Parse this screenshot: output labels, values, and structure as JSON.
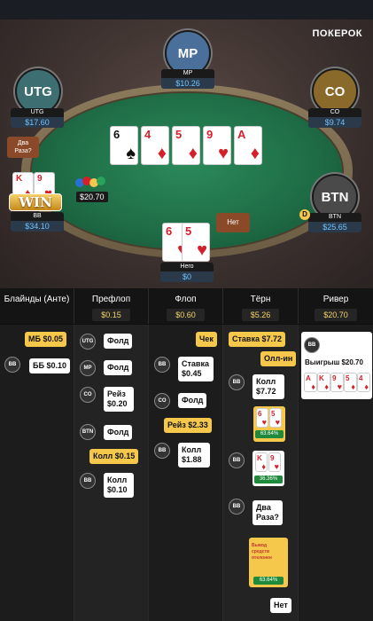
{
  "brand": "ПОКЕРОК",
  "seats": {
    "mp": {
      "name": "MP",
      "label": "MP",
      "stack": "$10.26"
    },
    "utg": {
      "name": "UTG",
      "label": "UTG",
      "stack": "$17.60"
    },
    "co": {
      "name": "CO",
      "label": "CO",
      "stack": "$9.74"
    },
    "bb": {
      "label": "BB",
      "stack": "$34.10",
      "win_badge": "WIN"
    },
    "btn": {
      "name": "BTN",
      "label": "BTN",
      "stack": "$25.65"
    },
    "hero": {
      "label": "Hero",
      "stack": "$0"
    }
  },
  "bubble_two_raise": "Два Раза?",
  "bubble_no": "Нет",
  "pot_chip": "$20.70",
  "board": [
    {
      "rank": "6",
      "suit": "♠",
      "color": "#111"
    },
    {
      "rank": "4",
      "suit": "♦",
      "color": "#d5202b"
    },
    {
      "rank": "5",
      "suit": "♦",
      "color": "#d5202b"
    },
    {
      "rank": "9",
      "suit": "♥",
      "color": "#d5202b"
    },
    {
      "rank": "A",
      "suit": "♦",
      "color": "#d5202b"
    }
  ],
  "bb_cards": [
    {
      "rank": "K",
      "suit": "♦"
    },
    {
      "rank": "9",
      "suit": "♥"
    }
  ],
  "hero_cards": [
    {
      "rank": "6",
      "suit": "♥"
    },
    {
      "rank": "5",
      "suit": "♥"
    }
  ],
  "streets": {
    "blinds": {
      "title": "Блайнды (Анте)"
    },
    "preflop": {
      "title": "Префлоп",
      "pot": "$0.15"
    },
    "flop": {
      "title": "Флоп",
      "pot": "$0.60"
    },
    "turn": {
      "title": "Тёрн",
      "pot": "$5.26"
    },
    "river": {
      "title": "Ривер",
      "pot": "$20.70"
    }
  },
  "actions": {
    "sb": "МБ $0.05",
    "bb": "ББ $0.10",
    "utg_fold": "Фолд",
    "mp_fold": "Фолд",
    "co_raise": "Рейз $0.20",
    "btn_fold": "Фолд",
    "call_015": "Колл $0.15",
    "bb_call": "Колл $0.10",
    "check": "Чек",
    "bb_bet": "Ставка $0.45",
    "co_fold": "Фолд",
    "raise_233": "Рейз $2.33",
    "bb_call_188": "Колл $1.88",
    "bet_772": "Ставка $7.72",
    "allin": "Олл-ин",
    "bb_call_772": "Колл $7.72",
    "equity1": "63.64%",
    "equity2": "36.36%",
    "two_raise": "Два Раза?",
    "withdraw": "Вывод средств отклонен",
    "equity3": "63.64%",
    "no": "Нет",
    "win": "Выигрыш $20.70"
  },
  "avatars": {
    "bb": "BB",
    "utg": "UTG",
    "mp": "MP",
    "co": "CO",
    "btn": "BTN"
  },
  "colors": {
    "accent_yellow": "#f5c84c",
    "stack_blue": "#6fc3ff",
    "felt_green": "#1e6b45",
    "equity_green": "#1f8a3b"
  }
}
